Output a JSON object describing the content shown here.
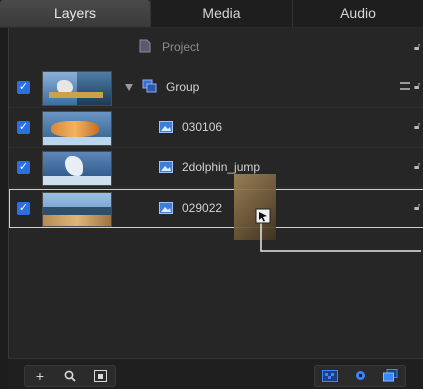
{
  "tabs": [
    "Layers",
    "Media",
    "Audio"
  ],
  "project": {
    "label": "Project"
  },
  "rows": [
    {
      "name": "Group"
    },
    {
      "name": "030106"
    },
    {
      "name": "2dolphin_jump"
    },
    {
      "name": "029022"
    }
  ],
  "bottom_bar": {
    "add": "+",
    "search": "🔍",
    "selected": true
  },
  "colors": {
    "accent": "#2c6fe0",
    "background": "#262626"
  }
}
